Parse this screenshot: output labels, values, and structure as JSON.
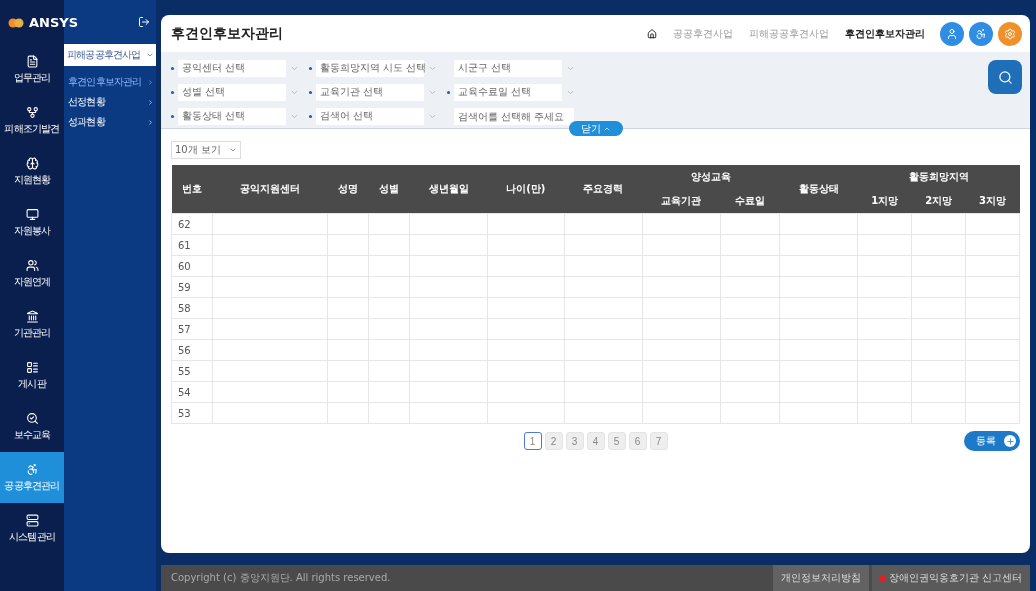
{
  "brand": {
    "name": "ANSYS"
  },
  "rail": [
    {
      "label": "업무관리",
      "selected": false
    },
    {
      "label": "피해조기발견",
      "selected": false
    },
    {
      "label": "지원현황",
      "selected": false
    },
    {
      "label": "자원봉사",
      "selected": false
    },
    {
      "label": "자원연계",
      "selected": false
    },
    {
      "label": "기관관리",
      "selected": false
    },
    {
      "label": "게시판",
      "selected": false
    },
    {
      "label": "보수교육",
      "selected": false
    },
    {
      "label": "공공후견관리",
      "selected": true
    },
    {
      "label": "시스템관리",
      "selected": false
    }
  ],
  "submenu": {
    "select": "피해공공후견사업",
    "items": [
      {
        "label": "후견인후보자관리",
        "selected": true
      },
      {
        "label": "선정현황",
        "selected": false
      },
      {
        "label": "성과현황",
        "selected": false
      }
    ]
  },
  "page_title": "후견인후보자관리",
  "breadcrumb": [
    {
      "label": "공공후견사업",
      "current": false
    },
    {
      "label": "피해공공후견사업",
      "current": false
    },
    {
      "label": "후견인후보자관리",
      "current": true
    }
  ],
  "filters": [
    [
      {
        "kind": "select",
        "bulleted": true,
        "value": "공익센터 선택"
      },
      {
        "kind": "select",
        "bulleted": true,
        "value": "활동희망지역 시도 선택"
      },
      {
        "kind": "select",
        "bulleted": false,
        "value": "시군구 선택"
      }
    ],
    [
      {
        "kind": "select",
        "bulleted": true,
        "value": "성별 선택"
      },
      {
        "kind": "select",
        "bulleted": true,
        "value": "교육기관 선택"
      },
      {
        "kind": "select",
        "bulleted": true,
        "value": "교육수료일 선택"
      }
    ],
    [
      {
        "kind": "select",
        "bulleted": true,
        "value": "활동상태 선택"
      },
      {
        "kind": "select",
        "bulleted": true,
        "value": "검색어 선택"
      },
      {
        "kind": "input",
        "bulleted": false,
        "placeholder": "검색어를 선택해 주세요"
      }
    ]
  ],
  "filter_toggle": {
    "label": "닫기"
  },
  "page_size": {
    "value": "10개 보기"
  },
  "table": {
    "columns": [
      {
        "label": "번호"
      },
      {
        "label": "공익지원센터"
      },
      {
        "label": "성명"
      },
      {
        "label": "성별"
      },
      {
        "label": "생년월일"
      },
      {
        "label": "나이(만)"
      },
      {
        "label": "주요경력"
      },
      {
        "label": "양성교육",
        "children": [
          "교육기관",
          "수료일"
        ]
      },
      {
        "label": "활동상태"
      },
      {
        "label": "활동희망지역",
        "children": [
          "1지망",
          "2지망",
          "3지망"
        ]
      }
    ],
    "rows": [
      "62",
      "61",
      "60",
      "59",
      "58",
      "57",
      "56",
      "55",
      "54",
      "53"
    ]
  },
  "pagination": [
    {
      "label": "1",
      "selected": true
    },
    {
      "label": "2",
      "selected": false
    },
    {
      "label": "3",
      "selected": false
    },
    {
      "label": "4",
      "selected": false
    },
    {
      "label": "5",
      "selected": false
    },
    {
      "label": "6",
      "selected": false
    },
    {
      "label": "7",
      "selected": false
    }
  ],
  "register_button": {
    "label": "등록"
  },
  "footer": {
    "copyright": "Copyright (c) 중앙지원단. All rights reserved.",
    "links": [
      {
        "label": "개인정보처리방침",
        "kind": "plain"
      },
      {
        "label": "장애인권익옹호기관 신고센터",
        "kind": "flagged"
      }
    ]
  }
}
